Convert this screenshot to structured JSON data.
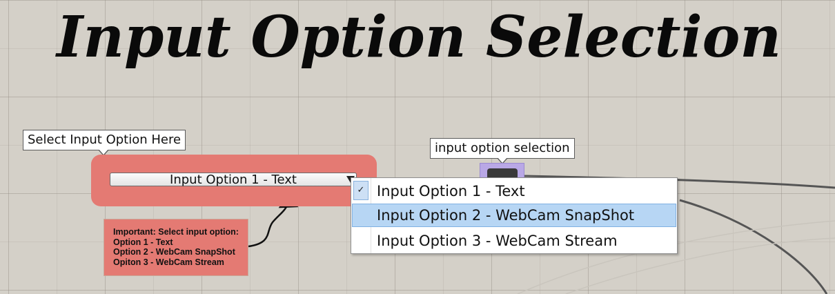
{
  "title": "Input Option Selection",
  "tooltip_select": "Select Input Option Here",
  "tooltip_node": "input option selection",
  "combo": {
    "selected": "Input Option 1 - Text"
  },
  "note": {
    "lines": [
      "Important: Select input option:",
      "Option 1 - Text",
      "Option 2 - WebCam SnapShot",
      "Opiton 3 - WebCam Stream"
    ]
  },
  "menu": {
    "items": [
      {
        "label": "Input Option 1 - Text",
        "checked": true,
        "highlighted": false
      },
      {
        "label": "Input Option 2 - WebCam SnapShot",
        "checked": false,
        "highlighted": true
      },
      {
        "label": "Input Option 3 - WebCam Stream",
        "checked": false,
        "highlighted": false
      }
    ],
    "check_glyph": "✓"
  },
  "colors": {
    "canvas": "#d4d0c8",
    "group_red": "#e47a73",
    "node_purple": "#b9a8e6",
    "highlight": "#b7d6f4"
  },
  "icons": {
    "combo_arrow": "triangle-down-icon",
    "check": "check-icon"
  }
}
